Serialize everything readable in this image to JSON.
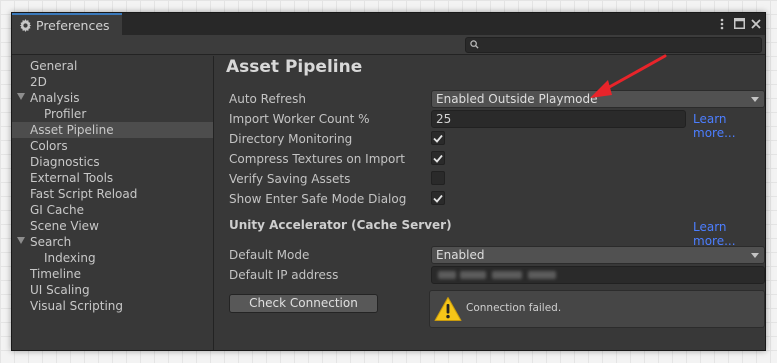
{
  "window": {
    "tab_title": "Preferences",
    "search": {
      "placeholder": "",
      "icon": "search-icon"
    },
    "window_buttons": [
      "menu-dots-icon",
      "maximize-icon",
      "close-icon"
    ]
  },
  "sidebar": {
    "items": [
      {
        "label": "General"
      },
      {
        "label": "2D"
      },
      {
        "label": "Analysis",
        "expanded": true
      },
      {
        "label": "Profiler"
      },
      {
        "label": "Asset Pipeline",
        "selected": true
      },
      {
        "label": "Colors"
      },
      {
        "label": "Diagnostics"
      },
      {
        "label": "External Tools"
      },
      {
        "label": "Fast Script Reload"
      },
      {
        "label": "GI Cache"
      },
      {
        "label": "Scene View"
      },
      {
        "label": "Search",
        "expanded": true
      },
      {
        "label": "Indexing"
      },
      {
        "label": "Timeline"
      },
      {
        "label": "UI Scaling"
      },
      {
        "label": "Visual Scripting"
      }
    ]
  },
  "main": {
    "title": "Asset Pipeline",
    "auto_refresh": {
      "label": "Auto Refresh",
      "value": "Enabled Outside Playmode"
    },
    "import_worker": {
      "label": "Import Worker Count %",
      "value": "25",
      "link": "Learn more..."
    },
    "checkboxes": [
      {
        "label": "Directory Monitoring",
        "checked": true
      },
      {
        "label": "Compress Textures on Import",
        "checked": true
      },
      {
        "label": "Verify Saving Assets",
        "checked": false
      },
      {
        "label": "Show Enter Safe Mode Dialog",
        "checked": true
      }
    ],
    "accelerator": {
      "section": "Unity Accelerator (Cache Server)",
      "link": "Learn more...",
      "default_mode": {
        "label": "Default Mode",
        "value": "Enabled"
      },
      "default_ip": {
        "label": "Default IP address"
      },
      "check_button": "Check Connection",
      "status_message": "Connection failed."
    }
  },
  "colors": {
    "link": "#4c7eff",
    "accent_tab": "#3a79bb",
    "annotation_arrow": "#e8242a",
    "warning": "#f5c518"
  }
}
